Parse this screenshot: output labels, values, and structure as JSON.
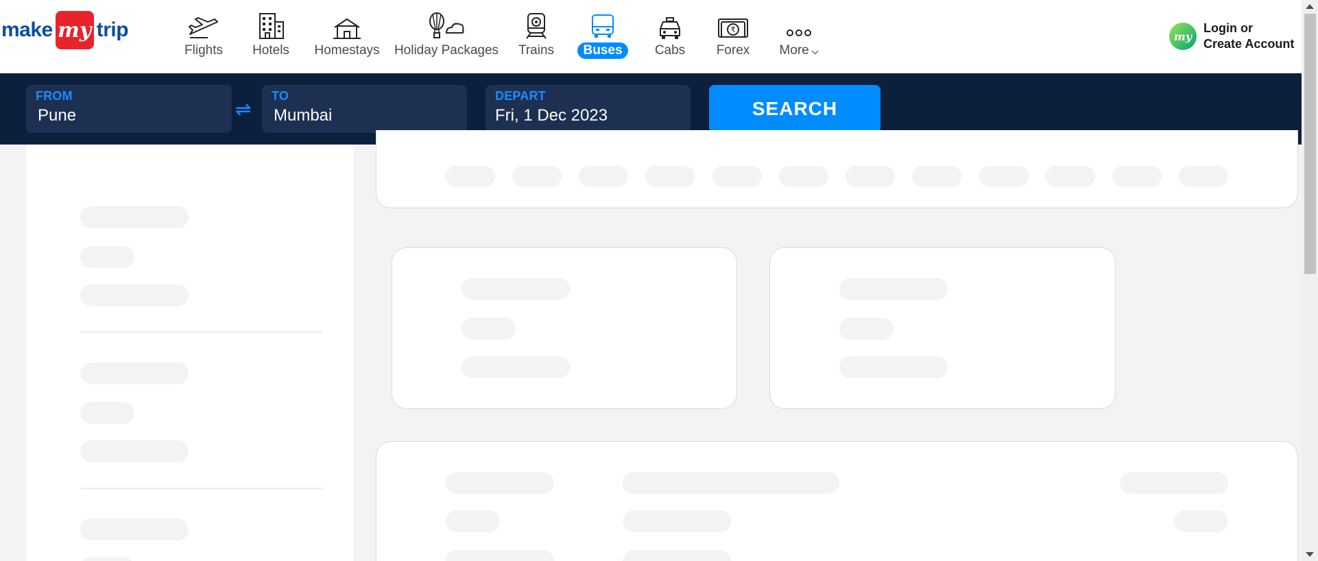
{
  "logo": {
    "word1": "make",
    "badge": "my",
    "word2": "trip"
  },
  "nav": [
    {
      "label": "Flights",
      "icon": "flight-icon"
    },
    {
      "label": "Hotels",
      "icon": "hotel-icon"
    },
    {
      "label": "Homestays",
      "icon": "homestay-icon"
    },
    {
      "label": "Holiday Packages",
      "icon": "holiday-packages-icon"
    },
    {
      "label": "Trains",
      "icon": "train-icon"
    },
    {
      "label": "Buses",
      "icon": "bus-icon",
      "active": true
    },
    {
      "label": "Cabs",
      "icon": "cab-icon"
    },
    {
      "label": "Forex",
      "icon": "forex-icon"
    },
    {
      "label": "More",
      "icon": "more-icon"
    }
  ],
  "login": {
    "avatar_text": "my",
    "line1": "Login or",
    "line2": "Create Account"
  },
  "search": {
    "from": {
      "label": "FROM",
      "value": "Pune"
    },
    "to": {
      "label": "TO",
      "value": "Mumbai"
    },
    "depart": {
      "label": "DEPART",
      "value": "Fri, 1 Dec 2023"
    },
    "button": "SEARCH"
  },
  "colors": {
    "brand_blue": "#008cff",
    "header_dark": "#0c1f3d",
    "logo_red": "#e8232a",
    "logo_blue": "#0b4ea2"
  }
}
